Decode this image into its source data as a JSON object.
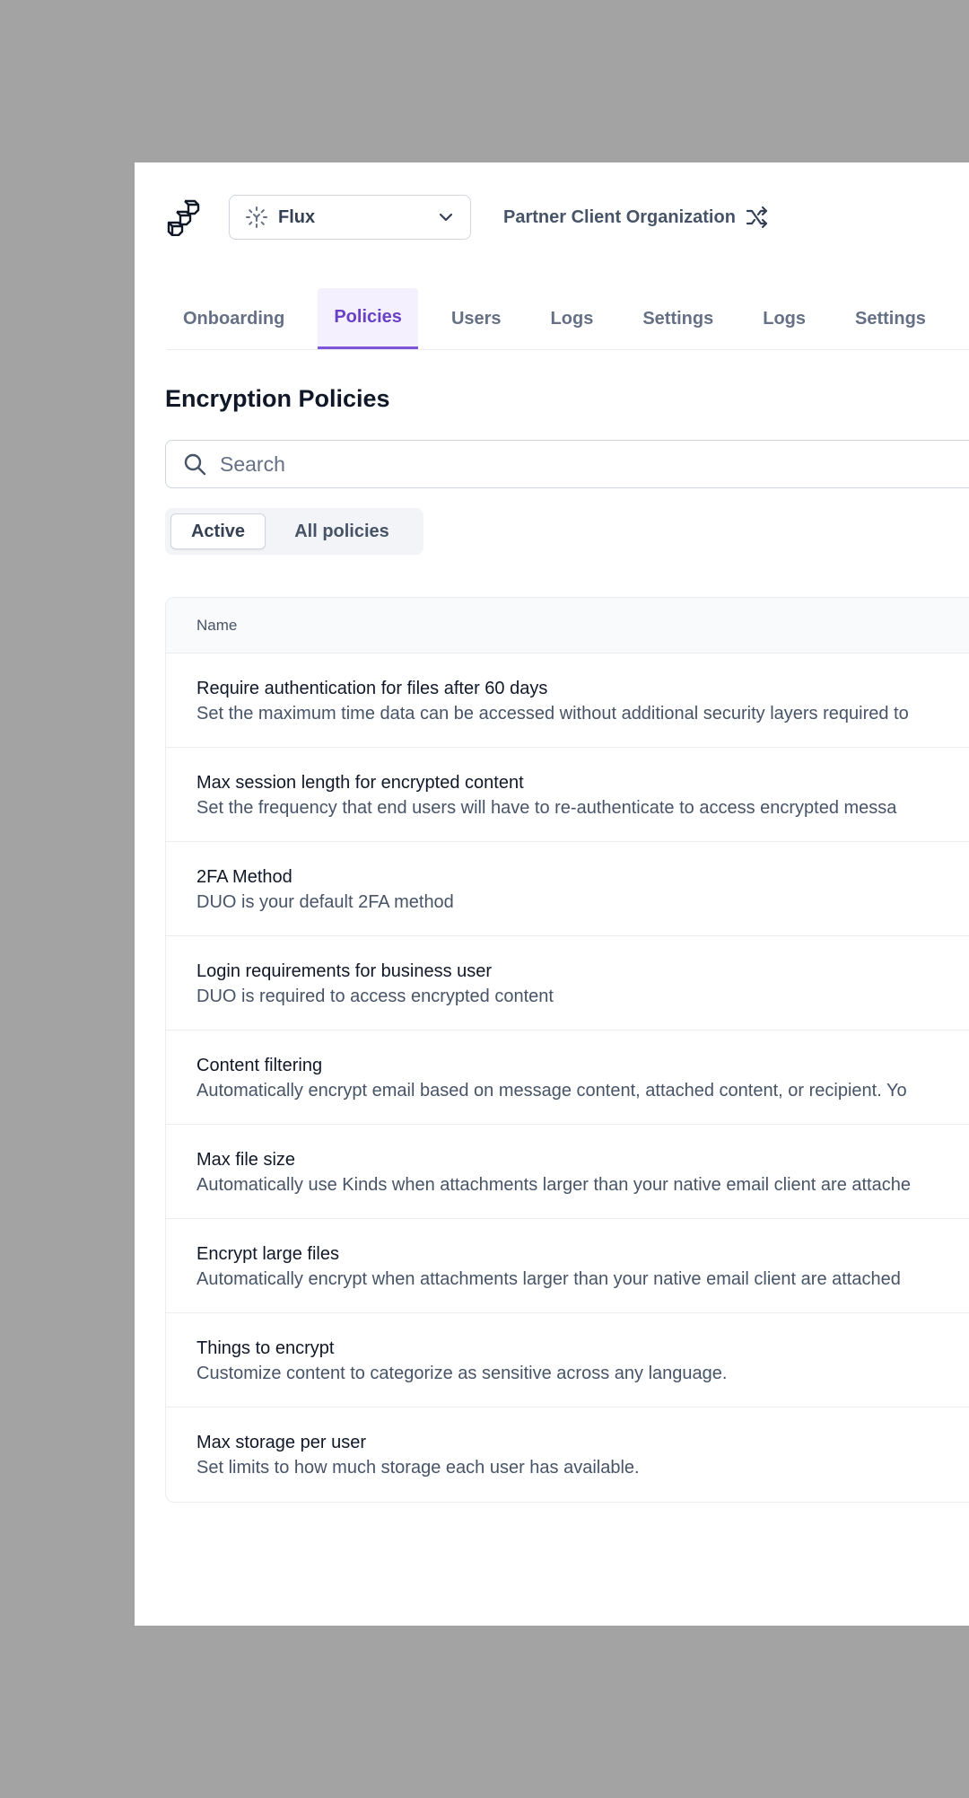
{
  "header": {
    "org_name": "Flux",
    "partner_name": "Partner Client Organization"
  },
  "tabs": [
    {
      "label": "Onboarding",
      "active": false
    },
    {
      "label": "Policies",
      "active": true
    },
    {
      "label": "Users",
      "active": false
    },
    {
      "label": "Logs",
      "active": false
    },
    {
      "label": "Settings",
      "active": false
    },
    {
      "label": "Logs",
      "active": false
    },
    {
      "label": "Settings",
      "active": false
    }
  ],
  "section": {
    "title": "Encryption Policies"
  },
  "search": {
    "placeholder": "Search",
    "value": ""
  },
  "filters": {
    "active_label": "Active",
    "all_label": "All policies",
    "selected": "Active"
  },
  "table": {
    "header_name": "Name",
    "rows": [
      {
        "title": "Require authentication for files after 60 days",
        "description": "Set the maximum time data can be accessed without additional security layers required to"
      },
      {
        "title": "Max session length for encrypted content",
        "description": "Set the frequency that end users will have to re-authenticate to access encrypted messa"
      },
      {
        "title": "2FA Method",
        "description": "DUO is your default 2FA method"
      },
      {
        "title": "Login requirements for business user",
        "description": "DUO is required to access  encrypted content"
      },
      {
        "title": "Content filtering",
        "description": "Automatically encrypt email based on message content, attached content, or recipient. Yo"
      },
      {
        "title": "Max file size",
        "description": "Automatically use Kinds when attachments larger than your native email client are attache"
      },
      {
        "title": "Encrypt large files",
        "description": "Automatically encrypt when attachments larger than your native email client are attached"
      },
      {
        "title": "Things to encrypt",
        "description": "Customize content to categorize as sensitive across any language."
      },
      {
        "title": "Max storage per user",
        "description": "Set limits to how much storage each user has available."
      }
    ]
  },
  "colors": {
    "accent": "#6941c6",
    "accent_bg": "#f4f0fe",
    "backdrop": "#a3a3a3"
  },
  "icons": {
    "logo": "stacked-blocks-logo",
    "org": "dashed-circle-icon",
    "dropdown": "chevron-down-icon",
    "switch": "shuffle-icon",
    "search": "search-icon"
  }
}
